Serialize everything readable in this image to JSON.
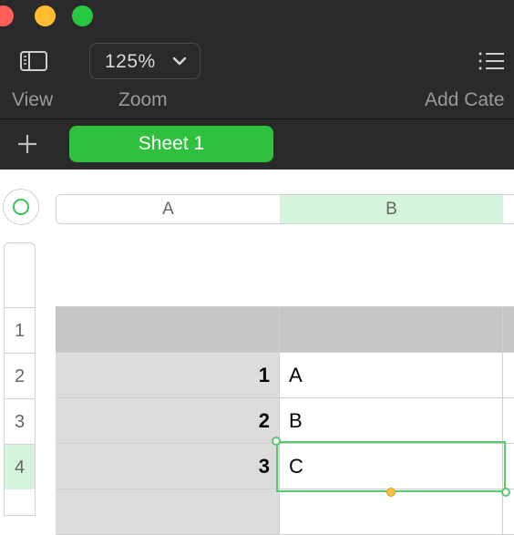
{
  "toolbar": {
    "zoom_value": "125%",
    "view_label": "View",
    "zoom_label": "Zoom",
    "category_label": "Add Cate"
  },
  "sheets": [
    {
      "label": "Sheet 1",
      "active": true
    }
  ],
  "columns": [
    {
      "label": "A"
    },
    {
      "label": "B",
      "selected": true
    }
  ],
  "rows": [
    {
      "label": "1"
    },
    {
      "label": "2"
    },
    {
      "label": "3"
    },
    {
      "label": "4",
      "selected": true
    }
  ],
  "table": {
    "header": [
      "",
      ""
    ],
    "body": [
      {
        "key": "1",
        "value": "A"
      },
      {
        "key": "2",
        "value": "B"
      },
      {
        "key": "3",
        "value": "C"
      }
    ]
  },
  "colors": {
    "accent": "#2fc13e",
    "selection_border": "#5ac86c",
    "selected_header": "#d5f4dc",
    "fill_handle": "#f6c23b"
  }
}
